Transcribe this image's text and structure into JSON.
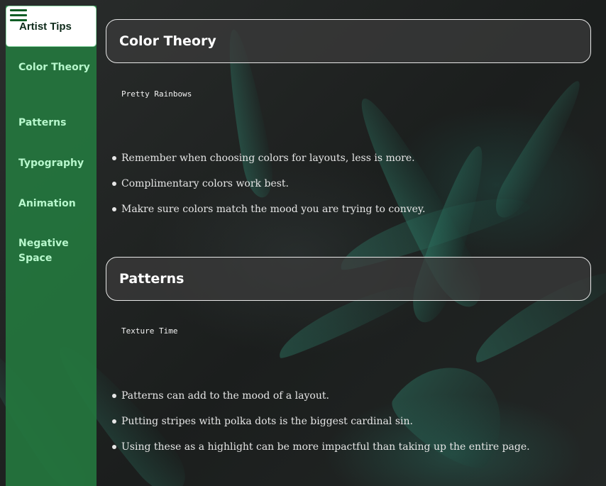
{
  "sidebar": {
    "menu_icon": "hamburger-icon",
    "brand": "Artist Tips",
    "items": [
      {
        "label": "Color Theory"
      },
      {
        "label": "Patterns"
      },
      {
        "label": "Typography"
      },
      {
        "label": "Animation"
      },
      {
        "label": "Negative Space"
      }
    ]
  },
  "sections": [
    {
      "title": "Color Theory",
      "subtitle": "Pretty Rainbows",
      "tips": [
        "Remember when choosing colors for layouts, less is more.",
        "Complimentary colors work best.",
        "Makre sure colors match the mood you are trying to convey."
      ]
    },
    {
      "title": "Patterns",
      "subtitle": "Texture Time",
      "tips": [
        "Patterns can add to the mood of a layout.",
        "Putting stripes with polka dots is the biggest cardinal sin.",
        "Using these as a highlight can be more impactful than taking up the entire page."
      ]
    }
  ],
  "colors": {
    "sidebar": "#24763e",
    "sidebar_text": "#b7f7cc",
    "brand_bg": "#ffffff",
    "header_bg": "#3c3c3c"
  }
}
